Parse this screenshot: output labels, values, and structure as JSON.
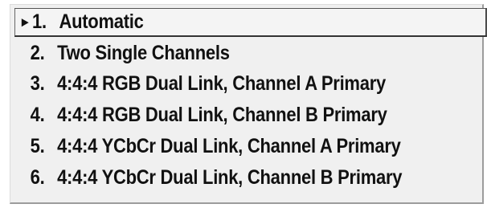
{
  "menu": {
    "selected_indicator": "►",
    "items": [
      {
        "number": "1.",
        "label": "Automatic",
        "selected": true
      },
      {
        "number": "2.",
        "label": "Two Single Channels",
        "selected": false
      },
      {
        "number": "3.",
        "label": "4:4:4 RGB Dual Link, Channel A Primary",
        "selected": false
      },
      {
        "number": "4.",
        "label": "4:4:4 RGB Dual Link, Channel B Primary",
        "selected": false
      },
      {
        "number": "5.",
        "label": "4:4:4 YCbCr Dual Link, Channel A Primary",
        "selected": false
      },
      {
        "number": "6.",
        "label": "4:4:4 YCbCr Dual Link, Channel B Primary",
        "selected": false
      }
    ]
  },
  "colors": {
    "panel_background": "#f0f0f0",
    "text": "#111111",
    "selection_border": "#555555"
  }
}
